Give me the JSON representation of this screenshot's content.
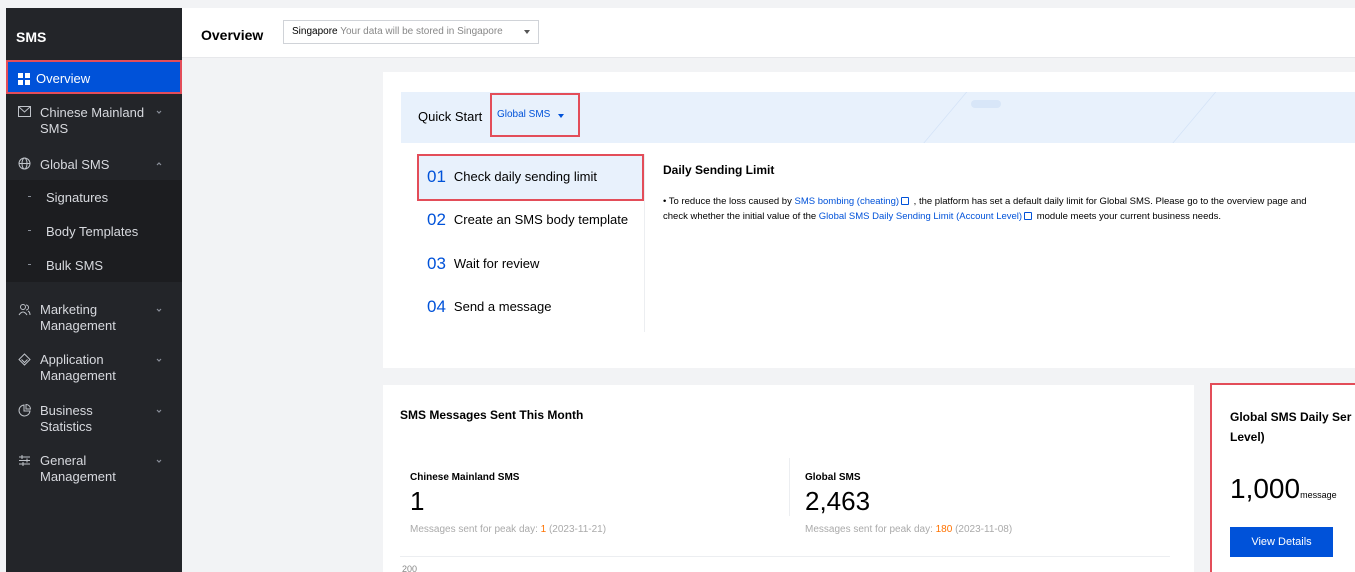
{
  "sidebar": {
    "title": "SMS",
    "items": [
      {
        "label": "Overview",
        "icon": "grid-icon"
      },
      {
        "label": "Chinese Mainland",
        "label2": "SMS",
        "icon": "mail-icon"
      },
      {
        "label": "Global SMS",
        "icon": "globe-icon"
      },
      {
        "label": "Marketing",
        "label2": "Management",
        "icon": "people-icon"
      },
      {
        "label": "Application",
        "label2": "Management",
        "icon": "app-icon"
      },
      {
        "label": "Business",
        "label2": "Statistics",
        "icon": "chart-icon"
      },
      {
        "label": "General",
        "label2": "Management",
        "icon": "settings-icon"
      }
    ],
    "global_sub": [
      "Signatures",
      "Body Templates",
      "Bulk SMS"
    ]
  },
  "topbar": {
    "title": "Overview",
    "region_value": "Singapore",
    "region_hint": "Your data will be stored in Singapore"
  },
  "quickstart": {
    "label": "Quick Start",
    "selected": "Global SMS",
    "steps": [
      {
        "num": "01",
        "label": "Check daily sending limit"
      },
      {
        "num": "02",
        "label": "Create an SMS body template"
      },
      {
        "num": "03",
        "label": "Wait for review"
      },
      {
        "num": "04",
        "label": "Send a message"
      }
    ],
    "detail_title": "Daily Sending Limit",
    "detail_p1": "• To reduce the loss caused by ",
    "detail_link1": "SMS bombing (cheating)",
    "detail_p2": " , the platform has set a default daily limit for Global SMS. Please go to the overview page and check whether the initial value of the ",
    "detail_link2": "Global SMS Daily Sending Limit (Account Level)",
    "detail_p3": " module meets your current business needs."
  },
  "messages": {
    "title": "SMS Messages Sent This Month",
    "mainland": {
      "label": "Chinese Mainland SMS",
      "value": "1",
      "peak_prefix": "Messages sent for peak day: ",
      "peak_count": "1",
      "peak_date": " (2023-11-21)"
    },
    "global": {
      "label": "Global SMS",
      "value": "2,463",
      "peak_prefix": "Messages sent for peak day: ",
      "peak_count": "180",
      "peak_date": " (2023-11-08)"
    },
    "axis_top": "200"
  },
  "limit": {
    "title_line1": "Global SMS Daily Ser",
    "title_line2": "Level)",
    "value": "1,000",
    "unit": "message",
    "button": "View Details"
  },
  "colors": {
    "accent": "#0052d9",
    "highlight_border": "#e34d59",
    "sidebar_bg": "#232529",
    "peak_highlight": "#ff7200"
  }
}
